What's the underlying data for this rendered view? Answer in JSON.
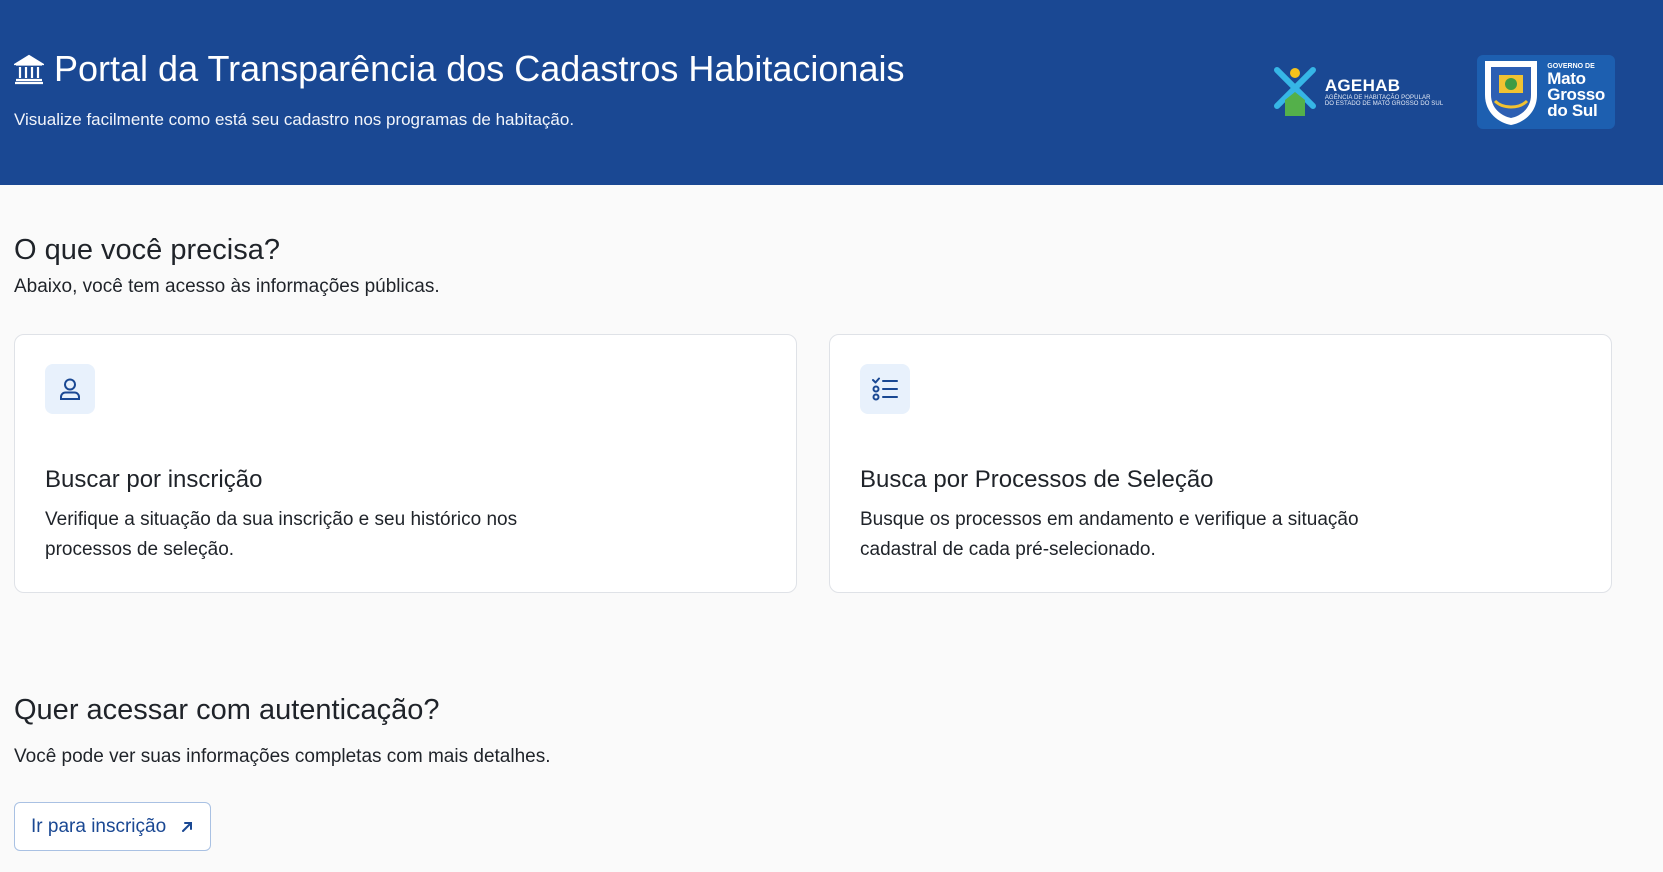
{
  "header": {
    "title": "Portal da Transparência dos Cadastros Habitacionais",
    "subtitle": "Visualize facilmente como está seu cadastro nos programas de habitação.",
    "title_icon": "bank-icon",
    "logos": {
      "agehab": {
        "name": "AGEHAB",
        "line1": "AGÊNCIA DE HABITAÇÃO POPULAR",
        "line2": "DO ESTADO DE MATO GROSSO DO SUL"
      },
      "governo": {
        "top": "GOVERNO DE",
        "line1": "Mato",
        "line2": "Grosso",
        "line3": "do Sul"
      }
    }
  },
  "public_section": {
    "title": "O que você precisa?",
    "description": "Abaixo, você tem acesso às informações públicas."
  },
  "cards": [
    {
      "icon": "user-icon",
      "title": "Buscar por inscrição",
      "description": "Verifique a situação da sua inscrição e seu histórico nos processos de seleção."
    },
    {
      "icon": "checklist-icon",
      "title": "Busca por Processos de Seleção",
      "description": "Busque os processos em andamento e verifique a situação cadastral de cada pré-selecionado."
    }
  ],
  "auth_section": {
    "title": "Quer acessar com autenticação?",
    "description": "Você pode ver suas informações completas com mais detalhes.",
    "button_label": "Ir para inscrição",
    "button_icon": "arrow-up-right-icon"
  },
  "colors": {
    "header_bg": "#1a4893",
    "page_bg": "#fafafa",
    "accent": "#1a4893",
    "icon_tile_bg": "#e8f1fc"
  }
}
